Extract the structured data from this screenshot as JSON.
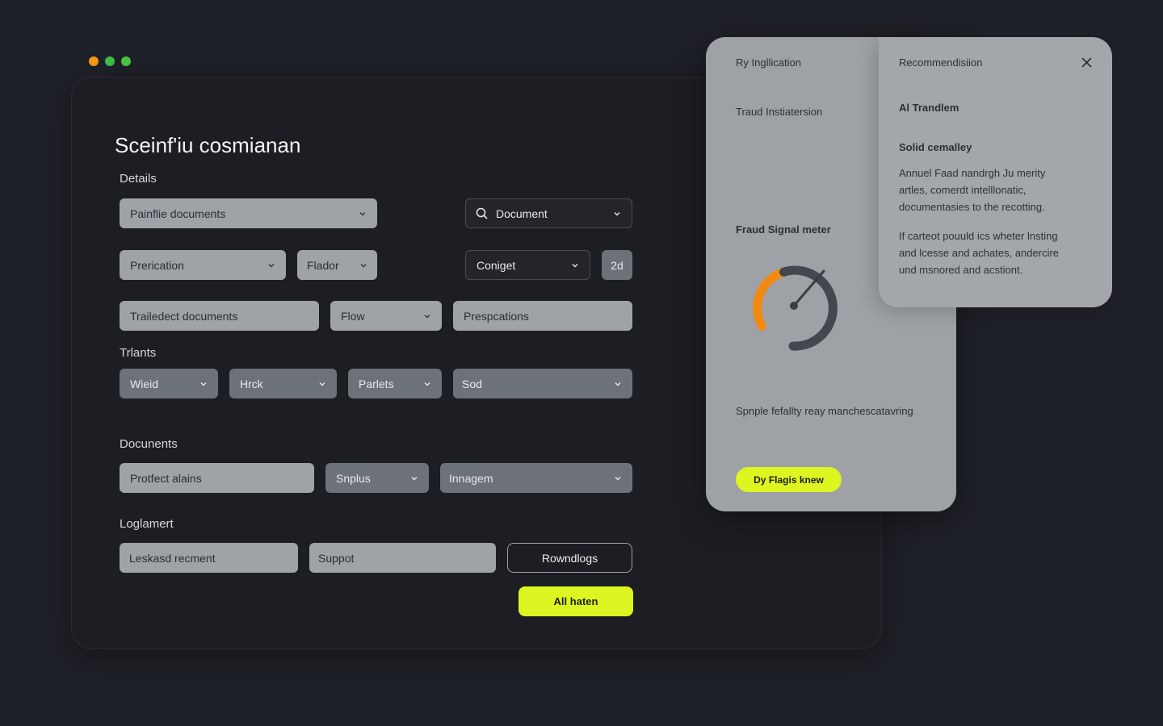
{
  "colors": {
    "accent": "#ddf520",
    "background": "#1f2128",
    "window": "#1c1e23",
    "panel": "#9ea1a6"
  },
  "window_controls": [
    "orange",
    "green",
    "green"
  ],
  "page": {
    "title": "Sceinf'iu cosmianan"
  },
  "sections": {
    "details": "Details",
    "trants": "Trlants",
    "documents": "Docunents",
    "logement": "Loglamert"
  },
  "details": {
    "field1": "Painflie documents",
    "search": {
      "label": "Document",
      "icon": "search-icon"
    },
    "field2": "Prerication",
    "field3": "Flador",
    "field4": "Coniget",
    "badge": "2d",
    "field5": "Trailedect documents",
    "field6": "Flow",
    "field7": "Prespcations"
  },
  "trants": {
    "f1": "Wieid",
    "f2": "Hrck",
    "f3": "Parlets",
    "f4": "Sod"
  },
  "documents": {
    "f1": "Protfect alains",
    "f2": "Snplus",
    "f3": "Innagem"
  },
  "logement": {
    "f1": "Leskasd recment",
    "f2": "Suppot",
    "button": "Rowndlogs"
  },
  "primary_button": "All haten",
  "side_panel": {
    "header_left": "Ry Ingllication",
    "sub_left": "Traud Instiatersion",
    "meter_title": "Fraud Signal meter",
    "meter_level": 0.4,
    "meter_caption": "Spnple fefallty reay manchescatavring",
    "button": "Dy Flagis knew"
  },
  "recommend_panel": {
    "header": "Recommendisiion",
    "close_icon": "close-icon",
    "title": "Al Trandlem",
    "subtitle": "Solid cemalley",
    "para1_lines": [
      "Annuel Faad nandrgh Ju merity",
      "artles, comerdt intelllonatic,",
      "documentasies to the recotting."
    ],
    "para2_lines": [
      "If carteot pouuld ics wheter lnsting",
      "and lcesse and achates, andercire",
      "und msnored and acstiont."
    ]
  }
}
